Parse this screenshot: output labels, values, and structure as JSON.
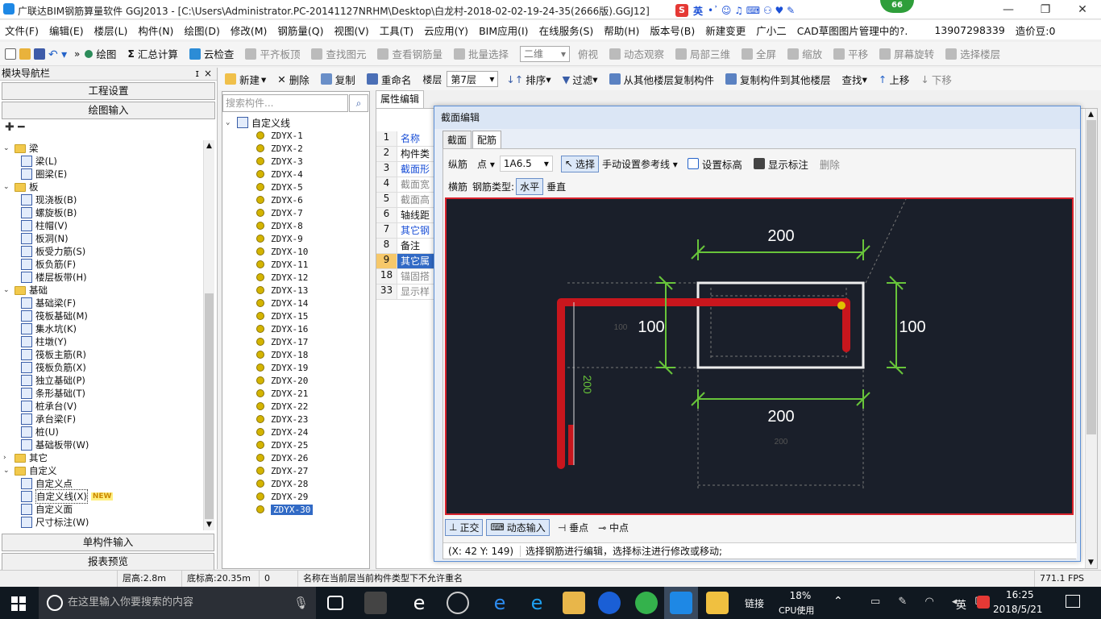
{
  "titlebar": {
    "title": "广联达BIM钢筋算量软件 GGJ2013 - [C:\\Users\\Administrator.PC-20141127NRHM\\Desktop\\白龙村-2018-02-02-19-24-35(2666版).GGJ12]",
    "badge": "66",
    "ime_label": "英",
    "minimize": "—",
    "restore": "❐",
    "close": "✕"
  },
  "menubar": {
    "items": [
      "文件(F)",
      "编辑(E)",
      "楼层(L)",
      "构件(N)",
      "绘图(D)",
      "修改(M)",
      "钢筋量(Q)",
      "视图(V)",
      "工具(T)",
      "云应用(Y)",
      "BIM应用(I)",
      "在线服务(S)",
      "帮助(H)",
      "版本号(B)",
      "新建变更",
      "广小二",
      "CAD草图图片管理中的?.",
      "13907298339",
      "造价豆:0"
    ]
  },
  "toolbar1": {
    "items": [
      "绘图",
      "汇总计算",
      "云检查",
      "平齐板顶",
      "查找图元",
      "查看钢筋量",
      "批量选择",
      "二维",
      "俯视",
      "动态观察",
      "局部三维",
      "全屏",
      "缩放",
      "平移",
      "屏幕旋转",
      "选择楼层"
    ]
  },
  "toolbar2": {
    "items": [
      "新建",
      "删除",
      "复制",
      "重命名",
      "楼层",
      "第7层",
      "排序",
      "过滤",
      "从其他楼层复制构件",
      "复制构件到其他楼层",
      "查找",
      "上移",
      "下移"
    ]
  },
  "nav": {
    "title": "模块导航栏",
    "pin": "ɪ",
    "close": "×",
    "btn_project": "工程设置",
    "btn_draw": "绘图输入",
    "btn_single": "单构件输入",
    "btn_report": "报表预览",
    "tree": [
      {
        "t": "梁",
        "lvl": 0,
        "folder": true,
        "exp": "⌄"
      },
      {
        "t": "梁(L)",
        "lvl": 1
      },
      {
        "t": "圈梁(E)",
        "lvl": 1
      },
      {
        "t": "板",
        "lvl": 0,
        "folder": true,
        "exp": "⌄"
      },
      {
        "t": "现浇板(B)",
        "lvl": 1
      },
      {
        "t": "螺旋板(B)",
        "lvl": 1
      },
      {
        "t": "柱帽(V)",
        "lvl": 1
      },
      {
        "t": "板洞(N)",
        "lvl": 1
      },
      {
        "t": "板受力筋(S)",
        "lvl": 1
      },
      {
        "t": "板负筋(F)",
        "lvl": 1
      },
      {
        "t": "楼层板带(H)",
        "lvl": 1
      },
      {
        "t": "基础",
        "lvl": 0,
        "folder": true,
        "exp": "⌄"
      },
      {
        "t": "基础梁(F)",
        "lvl": 1
      },
      {
        "t": "筏板基础(M)",
        "lvl": 1
      },
      {
        "t": "集水坑(K)",
        "lvl": 1
      },
      {
        "t": "柱墩(Y)",
        "lvl": 1
      },
      {
        "t": "筏板主筋(R)",
        "lvl": 1
      },
      {
        "t": "筏板负筋(X)",
        "lvl": 1
      },
      {
        "t": "独立基础(P)",
        "lvl": 1
      },
      {
        "t": "条形基础(T)",
        "lvl": 1
      },
      {
        "t": "桩承台(V)",
        "lvl": 1
      },
      {
        "t": "承台梁(F)",
        "lvl": 1
      },
      {
        "t": "桩(U)",
        "lvl": 1
      },
      {
        "t": "基础板带(W)",
        "lvl": 1
      },
      {
        "t": "其它",
        "lvl": 0,
        "folder": true,
        "exp": "›"
      },
      {
        "t": "自定义",
        "lvl": 0,
        "folder": true,
        "exp": "⌄"
      },
      {
        "t": "自定义点",
        "lvl": 1
      },
      {
        "t": "自定义线(X)",
        "lvl": 1,
        "sel": true
      },
      {
        "t": "自定义面",
        "lvl": 1
      },
      {
        "t": "尺寸标注(W)",
        "lvl": 1
      }
    ],
    "new_badge": "NEW"
  },
  "components": {
    "search_placeholder": "搜索构件...",
    "root": "自定义线",
    "items": [
      "ZDYX-1",
      "ZDYX-2",
      "ZDYX-3",
      "ZDYX-4",
      "ZDYX-5",
      "ZDYX-6",
      "ZDYX-7",
      "ZDYX-8",
      "ZDYX-9",
      "ZDYX-10",
      "ZDYX-11",
      "ZDYX-12",
      "ZDYX-13",
      "ZDYX-14",
      "ZDYX-15",
      "ZDYX-16",
      "ZDYX-17",
      "ZDYX-18",
      "ZDYX-19",
      "ZDYX-20",
      "ZDYX-21",
      "ZDYX-22",
      "ZDYX-23",
      "ZDYX-24",
      "ZDYX-25",
      "ZDYX-26",
      "ZDYX-27",
      "ZDYX-28",
      "ZDYX-29",
      "ZDYX-30"
    ],
    "selected": "ZDYX-30"
  },
  "props": {
    "tab": "属性编辑",
    "rows": [
      {
        "n": "1",
        "v": "名称",
        "c": "#1a4fd6"
      },
      {
        "n": "2",
        "v": "构件类",
        "c": "#111"
      },
      {
        "n": "3",
        "v": "截面形",
        "c": "#1a4fd6"
      },
      {
        "n": "4",
        "v": "截面宽",
        "c": "#888"
      },
      {
        "n": "5",
        "v": "截面高",
        "c": "#888"
      },
      {
        "n": "6",
        "v": "轴线距",
        "c": "#111"
      },
      {
        "n": "7",
        "v": "其它钢",
        "c": "#1a4fd6"
      },
      {
        "n": "8",
        "v": "备注",
        "c": "#111"
      },
      {
        "n": "9",
        "v": "其它属",
        "c": "#fff",
        "hl": true
      },
      {
        "n": "18",
        "v": "锚固搭",
        "c": "#888"
      },
      {
        "n": "33",
        "v": "显示样",
        "c": "#888"
      }
    ]
  },
  "dialog": {
    "title": "截面编辑",
    "tabs": [
      "截面",
      "配筋"
    ],
    "active_tab": "配筋",
    "row1": {
      "zongjin": "纵筋",
      "point": "点",
      "spec": "1A6.5",
      "select": "选择",
      "manual_ref": "手动设置参考线",
      "set_elev": "设置标高",
      "show_dim": "显示标注",
      "delete": "删除"
    },
    "row2": {
      "hengjin": "横筋",
      "type_label": "钢筋类型:",
      "horizontal": "水平",
      "vertical": "垂直"
    },
    "dims": {
      "top": "200",
      "bottom": "200",
      "left": "100",
      "right": "100",
      "vertical": "200",
      "faint_left": "100",
      "faint_bottom": "200"
    },
    "bottom": {
      "ortho": "正交",
      "dynamic": "动态输入",
      "perp": "垂点",
      "mid": "中点"
    },
    "coord": "(X: 42 Y: 149)",
    "hint": "选择钢筋进行编辑，选择标注进行修改或移动;"
  },
  "statusbar": {
    "floor_h": "层高:2.8m",
    "base_h": "底标高:20.35m",
    "zero": "0",
    "msg": "名称在当前层当前构件类型下不允许重名",
    "fps": "771.1 FPS"
  },
  "taskbar": {
    "search": "在这里输入你要搜索的内容",
    "link": "链接",
    "cpu": "18%",
    "cpu_label": "CPU使用",
    "ime": "英",
    "time": "16:25",
    "date": "2018/5/21"
  }
}
